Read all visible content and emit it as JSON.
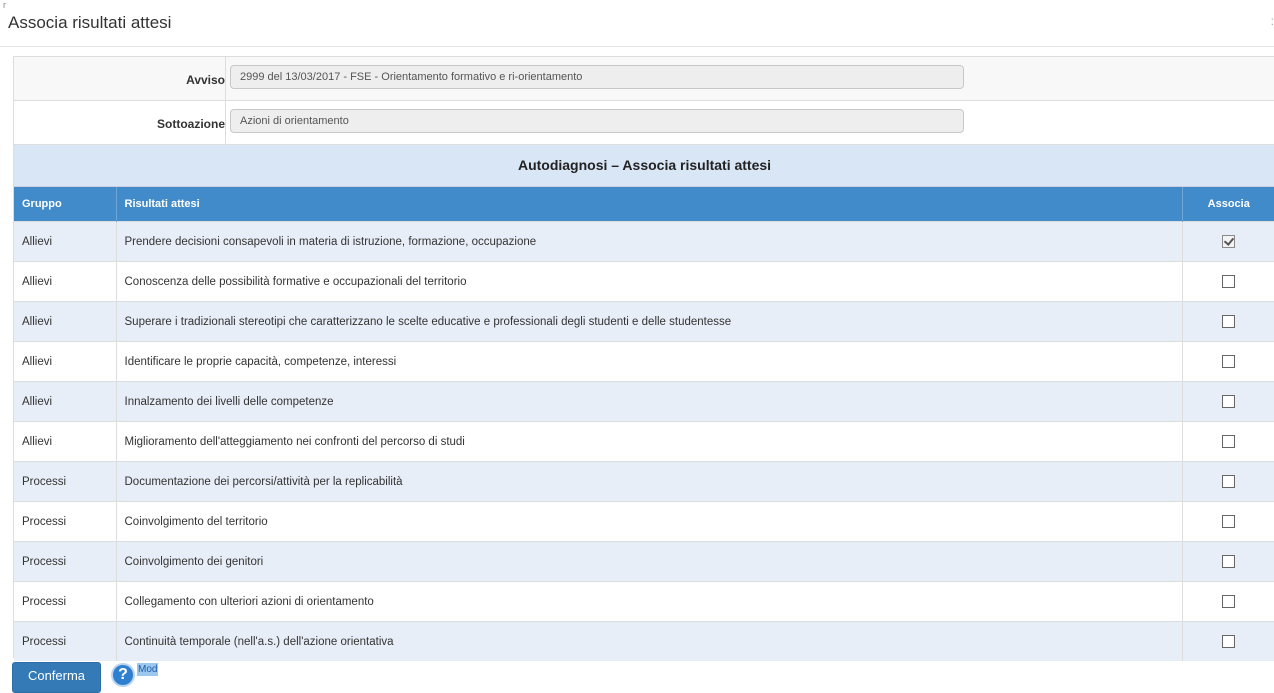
{
  "page": {
    "title": "Associa risultati attesi",
    "corner_mark": "r",
    "close_mark": ":"
  },
  "form": {
    "avviso": {
      "label": "Avviso",
      "value": "2999 del 13/03/2017 - FSE - Orientamento formativo e ri-orientamento"
    },
    "sottoazione": {
      "label": "Sottoazione",
      "value": "Azioni di orientamento"
    }
  },
  "section": {
    "title": "Autodiagnosi – Associa risultati attesi"
  },
  "table": {
    "headers": {
      "gruppo": "Gruppo",
      "risultati": "Risultati attesi",
      "associa": "Associa"
    },
    "rows": [
      {
        "gruppo": "Allievi",
        "risultato": "Prendere decisioni consapevoli in materia di istruzione, formazione, occupazione",
        "checked": true
      },
      {
        "gruppo": "Allievi",
        "risultato": "Conoscenza delle possibilità formative e occupazionali del territorio",
        "checked": false
      },
      {
        "gruppo": "Allievi",
        "risultato": "Superare i tradizionali stereotipi che caratterizzano le scelte educative e professionali degli studenti e delle studentesse",
        "checked": false
      },
      {
        "gruppo": "Allievi",
        "risultato": "Identificare le proprie capacità, competenze, interessi",
        "checked": false
      },
      {
        "gruppo": "Allievi",
        "risultato": "Innalzamento dei livelli delle competenze",
        "checked": false
      },
      {
        "gruppo": "Allievi",
        "risultato": "Miglioramento dell'atteggiamento nei confronti del percorso di studi",
        "checked": false
      },
      {
        "gruppo": "Processi",
        "risultato": "Documentazione dei percorsi/attività per la replicabilità",
        "checked": false
      },
      {
        "gruppo": "Processi",
        "risultato": "Coinvolgimento del territorio",
        "checked": false
      },
      {
        "gruppo": "Processi",
        "risultato": "Coinvolgimento dei genitori",
        "checked": false
      },
      {
        "gruppo": "Processi",
        "risultato": "Collegamento con ulteriori azioni di orientamento",
        "checked": false
      },
      {
        "gruppo": "Processi",
        "risultato": "Continuità temporale (nell'a.s.) dell'azione orientativa",
        "checked": false
      }
    ]
  },
  "footer": {
    "confirm_label": "Conferma",
    "help_icon_glyph": "?",
    "help_label": "Mod"
  }
}
